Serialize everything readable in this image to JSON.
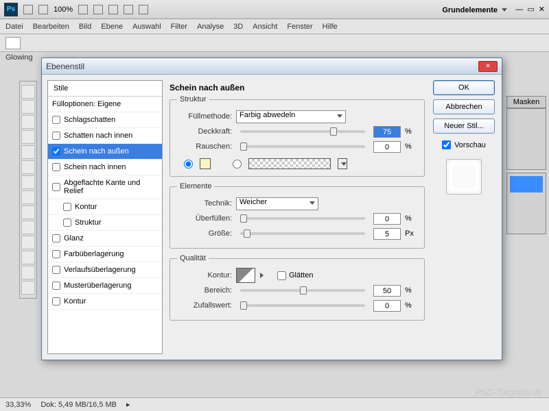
{
  "app": {
    "workspace": "Grundelemente",
    "zoom_pct": "100%"
  },
  "menu": [
    "Datei",
    "Bearbeiten",
    "Bild",
    "Ebene",
    "Auswahl",
    "Filter",
    "Analyse",
    "3D",
    "Ansicht",
    "Fenster",
    "Hilfe"
  ],
  "doc_tab": "Glowing",
  "right_panel_label": "Masken",
  "dialog": {
    "title": "Ebenenstil",
    "styles_header": "Stile",
    "fill_opts": "Fülloptionen: Eigene",
    "items": [
      {
        "label": "Schlagschatten",
        "checked": false
      },
      {
        "label": "Schatten nach innen",
        "checked": false
      },
      {
        "label": "Schein nach außen",
        "checked": true,
        "selected": true
      },
      {
        "label": "Schein nach innen",
        "checked": false
      },
      {
        "label": "Abgeflachte Kante und Relief",
        "checked": false
      },
      {
        "label": "Kontur",
        "sub": true,
        "checked": false
      },
      {
        "label": "Struktur",
        "sub": true,
        "checked": false
      },
      {
        "label": "Glanz",
        "checked": false
      },
      {
        "label": "Farbüberlagerung",
        "checked": false
      },
      {
        "label": "Verlaufsüberlagerung",
        "checked": false
      },
      {
        "label": "Musterüberlagerung",
        "checked": false
      },
      {
        "label": "Kontur",
        "checked": false
      }
    ],
    "panel_title": "Schein nach außen",
    "sections": {
      "structure": {
        "legend": "Struktur",
        "blend_label": "Füllmethode:",
        "blend_value": "Farbig abwedeln",
        "opacity_label": "Deckkraft:",
        "opacity_value": "75",
        "opacity_unit": "%",
        "noise_label": "Rauschen:",
        "noise_value": "0",
        "noise_unit": "%"
      },
      "elements": {
        "legend": "Elemente",
        "technique_label": "Technik:",
        "technique_value": "Weicher",
        "spread_label": "Überfüllen:",
        "spread_value": "0",
        "spread_unit": "%",
        "size_label": "Größe:",
        "size_value": "5",
        "size_unit": "Px"
      },
      "quality": {
        "legend": "Qualität",
        "contour_label": "Kontur:",
        "antialias_label": "Glätten",
        "range_label": "Bereich:",
        "range_value": "50",
        "range_unit": "%",
        "jitter_label": "Zufallswert:",
        "jitter_value": "0",
        "jitter_unit": "%"
      }
    },
    "buttons": {
      "ok": "OK",
      "cancel": "Abbrechen",
      "newstyle": "Neuer Stil...",
      "preview": "Vorschau"
    }
  },
  "status": {
    "zoom": "33,33%",
    "doc_size_label": "Dok:",
    "doc_size": "5,49 MB/16,5 MB"
  },
  "watermark": "PSD-Tutorials.de"
}
